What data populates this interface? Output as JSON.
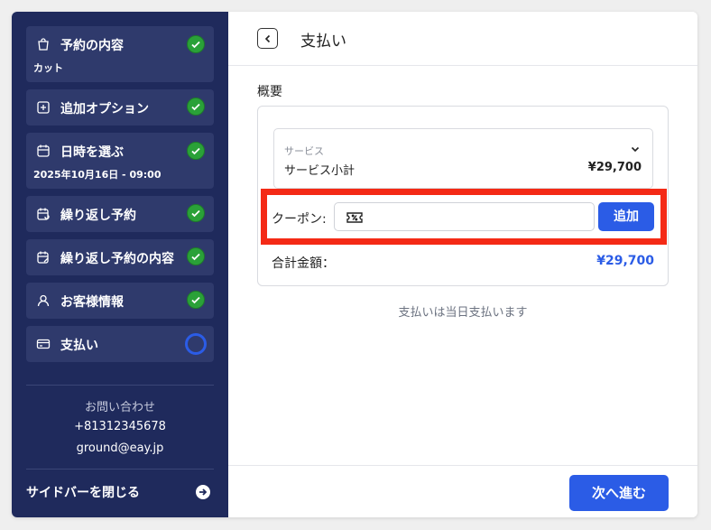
{
  "sidebar": {
    "steps": [
      {
        "label": "予約の内容",
        "sub": "カット",
        "icon": "shopping-bag-icon",
        "status": "done"
      },
      {
        "label": "追加オプション",
        "icon": "plus-square-icon",
        "status": "done"
      },
      {
        "label": "日時を選ぶ",
        "sub": "2025年10月16日 - 09:00",
        "icon": "calendar-icon",
        "status": "done"
      },
      {
        "label": "繰り返し予約",
        "icon": "calendar-repeat-icon",
        "status": "done"
      },
      {
        "label": "繰り返し予約の内容",
        "icon": "calendar-edit-icon",
        "status": "done"
      },
      {
        "label": "お客様情報",
        "icon": "user-icon",
        "status": "done"
      },
      {
        "label": "支払い",
        "icon": "credit-card-icon",
        "status": "current"
      }
    ],
    "contact": {
      "heading": "お問い合わせ",
      "phone": "+81312345678",
      "email": "ground@eay.jp"
    },
    "close_label": "サイドバーを閉じる"
  },
  "main": {
    "title": "支払い",
    "section_title": "概要",
    "service": {
      "caption": "サービス",
      "name": "サービス小計",
      "price": "¥29,700"
    },
    "coupon": {
      "label": "クーポン:",
      "value": "",
      "add_label": "追加"
    },
    "total": {
      "label": "合計金額：",
      "value": "¥29,700"
    },
    "note": "支払いは当日支払います",
    "next_label": "次へ進む"
  },
  "colors": {
    "sidebar_bg": "#1f2a5c",
    "accent": "#2b5ce6",
    "done": "#2aa138",
    "highlight": "#f42a16"
  }
}
